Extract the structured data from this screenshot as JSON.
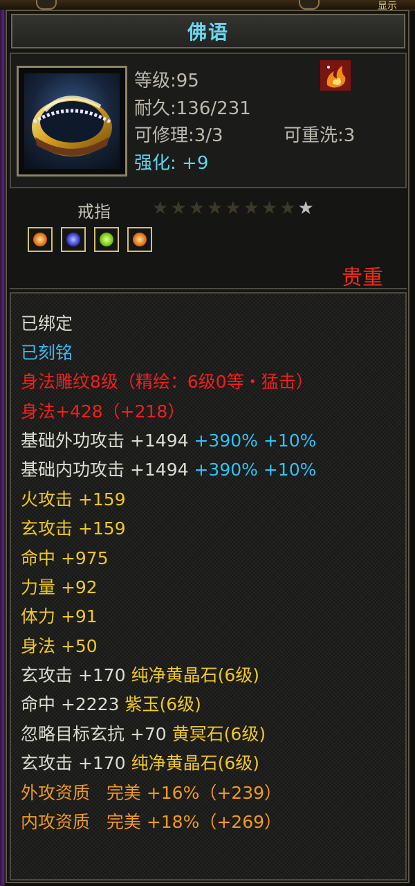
{
  "window": {
    "corner_text": "显示"
  },
  "item": {
    "name": "佛语",
    "level": "等级:95",
    "durability": "耐久:136/231",
    "repairable": "可修理:3/3",
    "rewash": "可重洗:3",
    "enhance_label": "强化:",
    "enhance_value": "+9",
    "type": "戒指",
    "stars_total": 9,
    "stars_lit": 1,
    "rarity": "贵重",
    "gems": [
      "orange-gem",
      "blue-gem",
      "green-gem",
      "orange-gem"
    ],
    "icon": "gold-ring-icon",
    "effect_icon": "fire-effect-icon"
  },
  "attributes": {
    "bound": "已绑定",
    "engraved": "已刻铭",
    "carving": "身法雕纹8级（精绘：6级0等・猛击）",
    "agility_bonus": "身法+428（+218）",
    "base_ext_attack": {
      "label": "基础外功攻击 +1494",
      "pct1": "+390%",
      "pct2": "+10%"
    },
    "base_int_attack": {
      "label": "基础内功攻击 +1494",
      "pct1": "+390%",
      "pct2": "+10%"
    },
    "fire_attack": "火攻击 +159",
    "mystic_attack": "玄攻击 +159",
    "hit": "命中 +975",
    "strength": "力量 +92",
    "stamina": "体力 +91",
    "agility": "身法 +50",
    "gem_line1": {
      "stat": "玄攻击 +170",
      "gem": "纯净黄晶石(6级)"
    },
    "gem_line2": {
      "stat": "命中 +2223",
      "gem": "紫玉(6级)"
    },
    "gem_line3": {
      "stat": "忽略目标玄抗 +70",
      "gem": "黄冥石(6级)"
    },
    "gem_line4": {
      "stat": "玄攻击 +170",
      "gem": "纯净黄晶石(6级)"
    },
    "ext_quality": {
      "label": "外攻资质",
      "grade": "完美",
      "value": "+16%（+239）"
    },
    "int_quality": {
      "label": "内攻资质",
      "grade": "完美",
      "value": "+18%（+269）"
    }
  },
  "colors": {
    "title": "#6ad8f0",
    "enhance": "#5fd6ee",
    "rarity": "#f02a18",
    "bound": "#dcdcd0",
    "engraved": "#3ab8f0",
    "red_attr": "#f41e1e",
    "yellow_attr": "#f0c81e",
    "orange_attr": "#f09a1e",
    "blue_pct": "#2bc4f8"
  }
}
